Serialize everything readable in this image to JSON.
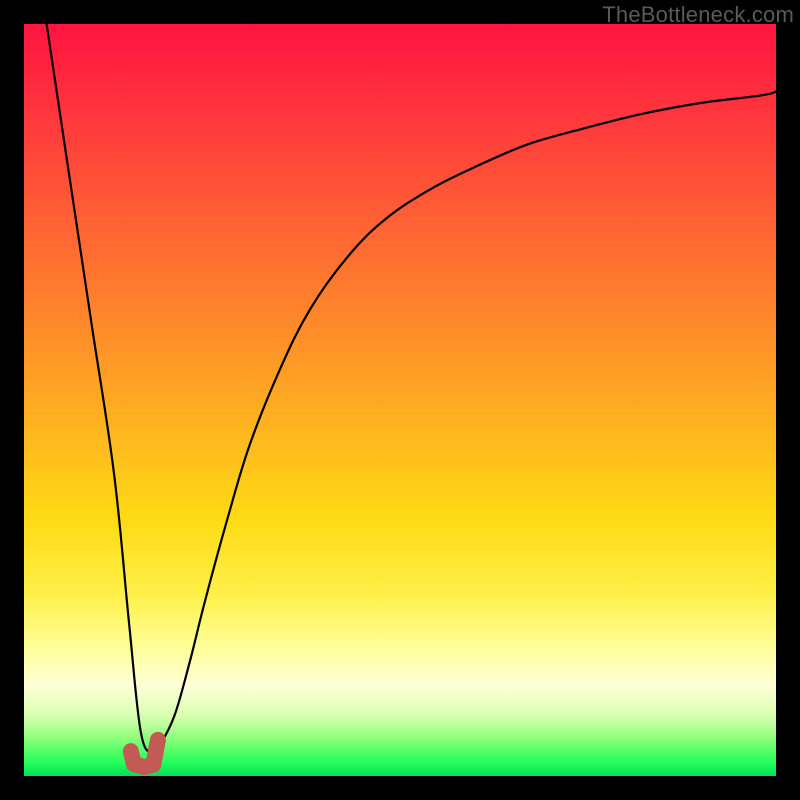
{
  "watermark": "TheBottleneck.com",
  "colors": {
    "background": "#000000",
    "gradient_top": "#ff1440",
    "gradient_mid1": "#ff8a2a",
    "gradient_mid2": "#ffdb14",
    "gradient_mid3": "#ffff9a",
    "gradient_bottom": "#00e05a",
    "curve": "#000000",
    "marker": "#c35a53"
  },
  "chart_data": {
    "type": "line",
    "title": "",
    "xlabel": "",
    "ylabel": "",
    "xlim": [
      0,
      100
    ],
    "ylim": [
      0,
      100
    ],
    "grid": false,
    "legend": null,
    "description": "Bottleneck-style V curve: steep left descent to a minimum near x≈16, then rising saturating curve toward the right.",
    "series": [
      {
        "name": "bottleneck-curve",
        "x": [
          3,
          6,
          9,
          12,
          14,
          15.5,
          17,
          18,
          20,
          22,
          24,
          27,
          30,
          34,
          38,
          43,
          48,
          54,
          60,
          67,
          74,
          82,
          90,
          98,
          100
        ],
        "y": [
          100,
          80,
          60,
          40,
          20,
          6,
          3,
          4,
          8,
          15,
          23,
          34,
          44,
          54,
          62,
          69,
          74,
          78,
          81,
          84,
          86,
          88,
          89.5,
          90.5,
          91
        ]
      }
    ],
    "marker": {
      "name": "J-marker",
      "color": "#c35a53",
      "points_xy": [
        [
          14.2,
          3.3
        ],
        [
          14.6,
          1.6
        ],
        [
          16.0,
          1.2
        ],
        [
          17.2,
          1.5
        ],
        [
          17.8,
          4.8
        ]
      ]
    }
  }
}
